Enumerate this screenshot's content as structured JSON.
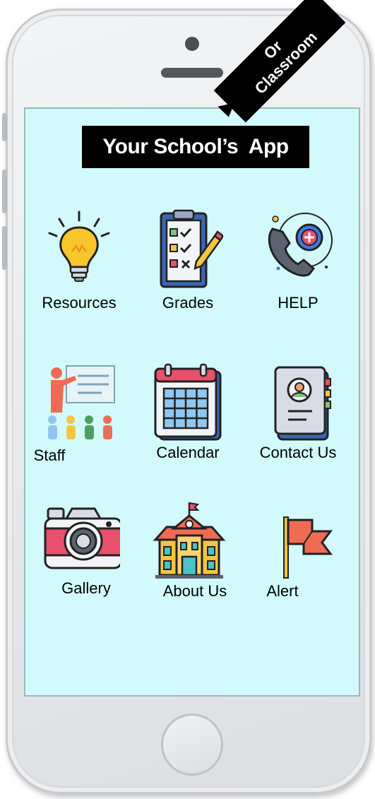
{
  "app": {
    "title": "Your School’s  App",
    "banner_line1": "Or",
    "banner_line2": "Classroom"
  },
  "tiles": [
    {
      "label": "Resources",
      "icon": "lightbulb-icon"
    },
    {
      "label": "Grades",
      "icon": "clipboard-checklist-icon"
    },
    {
      "label": "HELP",
      "icon": "phone-help-icon"
    },
    {
      "label": "Staff",
      "icon": "teacher-presentation-icon"
    },
    {
      "label": "Calendar",
      "icon": "calendar-icon"
    },
    {
      "label": "Contact Us",
      "icon": "contact-book-icon"
    },
    {
      "label": "Gallery",
      "icon": "camera-icon"
    },
    {
      "label": "About Us",
      "icon": "school-building-icon"
    },
    {
      "label": "Alert",
      "icon": "flag-icon"
    }
  ],
  "colors": {
    "screen_background": "#d2fafc",
    "title_background": "#000000",
    "title_text": "#ffffff"
  }
}
